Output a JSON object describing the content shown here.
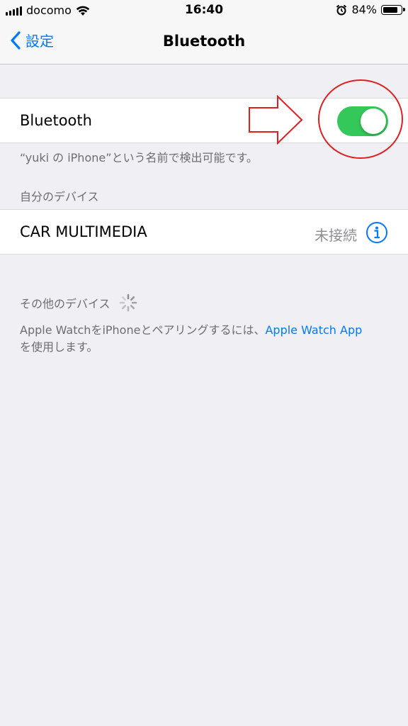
{
  "status_bar": {
    "carrier": "docomo",
    "time": "16:40",
    "battery_percent": "84%",
    "battery_level": 0.84,
    "icons": [
      "signal-icon",
      "wifi-icon",
      "alarm-icon",
      "battery-icon"
    ]
  },
  "nav": {
    "back_label": "設定",
    "title": "Bluetooth"
  },
  "bluetooth": {
    "label": "Bluetooth",
    "enabled": true,
    "footnote": "“yuki の iPhone”という名前で検出可能です。"
  },
  "my_devices": {
    "header": "自分のデバイス",
    "items": [
      {
        "name": "CAR MULTIMEDIA",
        "status": "未接続",
        "icon": "info-icon"
      }
    ]
  },
  "other_devices": {
    "header": "その他のデバイス",
    "icon": "loading-spinner-icon"
  },
  "help": {
    "text_before": "Apple WatchをiPhoneとペアリングするには、",
    "link": "Apple Watch App",
    "text_after": "を使用します。"
  },
  "colors": {
    "accent": "#007aff",
    "toggle_on": "#34c759",
    "annotation": "#e02020",
    "background": "#efeff4"
  }
}
